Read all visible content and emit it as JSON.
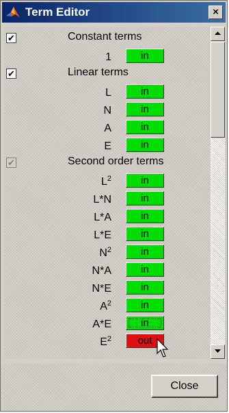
{
  "window": {
    "title": "Term Editor",
    "close_glyph": "×"
  },
  "groups": {
    "constant": {
      "label": "Constant terms",
      "checked": true,
      "check_glyph": "✔"
    },
    "linear": {
      "label": "Linear terms",
      "checked": true,
      "check_glyph": "✔"
    },
    "second": {
      "label": "Second order terms",
      "checked": true,
      "disabled": true,
      "check_glyph": "✔"
    }
  },
  "terms": [
    {
      "base": "1",
      "sup": "",
      "state": "in"
    },
    {
      "base": "L",
      "sup": "",
      "state": "in"
    },
    {
      "base": "N",
      "sup": "",
      "state": "in"
    },
    {
      "base": "A",
      "sup": "",
      "state": "in"
    },
    {
      "base": "E",
      "sup": "",
      "state": "in"
    },
    {
      "base": "L",
      "sup": "2",
      "state": "in"
    },
    {
      "base": "L*N",
      "sup": "",
      "state": "in"
    },
    {
      "base": "L*A",
      "sup": "",
      "state": "in"
    },
    {
      "base": "L*E",
      "sup": "",
      "state": "in"
    },
    {
      "base": "N",
      "sup": "2",
      "state": "in"
    },
    {
      "base": "N*A",
      "sup": "",
      "state": "in"
    },
    {
      "base": "N*E",
      "sup": "",
      "state": "in"
    },
    {
      "base": "A",
      "sup": "2",
      "state": "in"
    },
    {
      "base": "A*E",
      "sup": "",
      "state": "in"
    },
    {
      "base": "E",
      "sup": "2",
      "state": "out"
    }
  ],
  "footer": {
    "close_label": "Close"
  },
  "icons": {
    "app": "matlab-logo-icon",
    "scroll_up": "arrow-up-icon",
    "scroll_down": "arrow-down-icon",
    "pointer": "mouse-pointer-icon"
  },
  "colors": {
    "in": "#00dd00",
    "out": "#dd1111",
    "titlebar": "#0a246a"
  }
}
